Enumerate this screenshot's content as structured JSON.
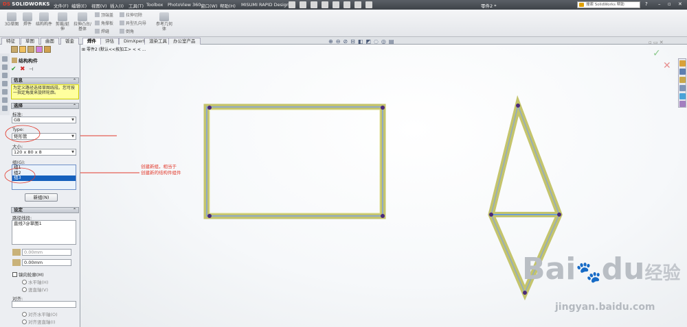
{
  "app": {
    "logo": "SOLIDWORKS",
    "document_title": "零件2 *"
  },
  "menu": [
    "文件(F)",
    "编辑(E)",
    "视图(V)",
    "插入(I)",
    "工具(T)",
    "Toolbox",
    "PhotoView 360",
    "窗口(W)",
    "帮助(H)",
    "MISUMI RAPID Design"
  ],
  "search": {
    "placeholder": "搜索 SolidWorks 帮助"
  },
  "ribbon": {
    "big": [
      "3D草图",
      "焊件",
      "结构构件",
      "剪裁/延伸",
      "拉伸凸台/基体",
      "参考几何体"
    ],
    "small": [
      "顶端盖",
      "角撑板",
      "焊缝",
      "拉伸切除",
      "异型孔向导",
      "倒角"
    ]
  },
  "tabs": [
    "焊件",
    "评估",
    "DimXpert",
    "渲染工具",
    "办公室产品"
  ],
  "panel_tabs": [
    "特征",
    "草图",
    "曲面",
    "钣金"
  ],
  "tree": {
    "label": "零件2 (默认<<按加工> < < ..."
  },
  "pm": {
    "title": "结构构件",
    "info_head": "信息",
    "info_text": "为定义路径选择草图线段。您可按一指定角度来旋转轮廓。",
    "selection_head": "选择",
    "standard_label": "标准:",
    "standard_value": "GB",
    "type_label": "Type:",
    "type_value": "矩形管",
    "size_label": "大小:",
    "size_value": "120 x 80 x 8",
    "group_label": "组(G):",
    "groups": [
      "组1",
      "组2",
      "组3"
    ],
    "selected_group": 2,
    "new_group_button": "新组(N)",
    "settings_head": "设定",
    "path_label": "路径线段:",
    "path_value": "直线7@草图1",
    "angle1": "0.00mm",
    "angle2": "0.00mm",
    "mirror_label": "镜向轮廓(M)",
    "horizontal_axis": "水平轴(H)",
    "vertical_axis": "竖直轴(V)",
    "align_label": "对齐:",
    "align_horizontal": "对齐水平轴(O)",
    "align_vertical": "对齐竖直轴(I)"
  },
  "annotation": {
    "line1": "创建新组，相当于",
    "line2": "创建新的结构件组件"
  },
  "watermark": {
    "brand": "Bai",
    "brand2": "du",
    "jingyan": "经验",
    "url": "jingyan.baidu.com"
  },
  "colors": {
    "accent": "#e2392b",
    "frame": "#c9c96a",
    "selected": "#1560bd"
  }
}
